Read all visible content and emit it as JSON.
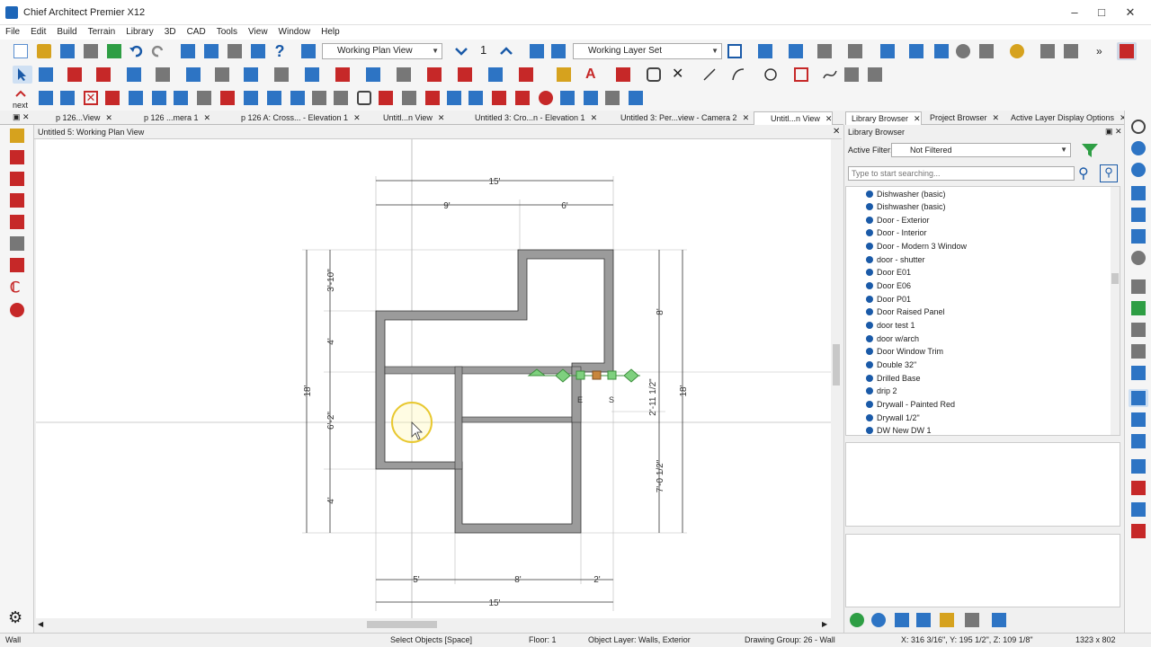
{
  "window": {
    "title": "Chief Architect Premier X12"
  },
  "menu": [
    "File",
    "Edit",
    "Build",
    "Terrain",
    "Library",
    "3D",
    "CAD",
    "Tools",
    "View",
    "Window",
    "Help"
  ],
  "toolbar": {
    "plan_view_dropdown": "Working Plan View",
    "floor_number": "1",
    "layer_set_dropdown": "Working Layer Set",
    "next_label": "next"
  },
  "tabs": [
    {
      "label": "p 126...View"
    },
    {
      "label": "p 126 ...mera 1"
    },
    {
      "label": "p 126 A: Cross... - Elevation 1"
    },
    {
      "label": "Untitl...n View"
    },
    {
      "label": "Untitled 3: Cro...n - Elevation 1"
    },
    {
      "label": "Untitled 3: Per...view - Camera 2"
    },
    {
      "label": "Untitl...n View"
    }
  ],
  "panel_tabs": [
    {
      "label": "Library Browser"
    },
    {
      "label": "Project Browser"
    },
    {
      "label": "Active Layer Display Options"
    }
  ],
  "view": {
    "title": "Untitled 5:  Working Plan View"
  },
  "plan": {
    "dims": {
      "top_total": "15'",
      "top_left": "9'",
      "top_right": "6'",
      "left_seg1": "3'-10\"",
      "left_seg2": "4'",
      "left_seg3": "6'-2\"",
      "left_seg4": "4'",
      "left_total": "18'",
      "right_seg1": "8'",
      "right_seg2": "2'-11 1/2\"",
      "right_seg3": "7'-0 1/2\"",
      "right_total": "18'",
      "bottom_left": "5'",
      "bottom_mid": "8'",
      "bottom_right": "2'",
      "bottom_total": "15'",
      "marker_e": "E",
      "marker_s": "S"
    }
  },
  "library": {
    "title": "Library Browser",
    "filter_label": "Active Filter:",
    "filter_value": "Not Filtered",
    "search_placeholder": "Type to start searching...",
    "items": [
      "Dishwasher (basic)",
      "Dishwasher (basic)",
      "Door - Exterior",
      "Door - Interior",
      "Door - Modern 3 Window",
      "door - shutter",
      "Door E01",
      "Door E06",
      "Door P01",
      "Door Raised Panel",
      "door test 1",
      "door w/arch",
      "Door Window Trim",
      "Double 32\"",
      "Drilled Base",
      "drip 2",
      "Drywall - Painted Red",
      "Drywall 1/2\"",
      "DW New DW 1"
    ]
  },
  "status": {
    "left": "Wall",
    "mode": "Select Objects [Space]",
    "floor": "Floor: 1",
    "layer": "Object Layer: Walls,  Exterior",
    "group": "Drawing Group: 26 - Wall",
    "coords": "X: 316 3/16\", Y: 195 1/2\", Z: 109 1/8\"",
    "size": "1323 x 802"
  },
  "colors": {
    "accent": "#2d74c4",
    "wall_fill": "#9b9b9b",
    "selection": "#4caf50",
    "cursor_ring": "#e8c830"
  }
}
